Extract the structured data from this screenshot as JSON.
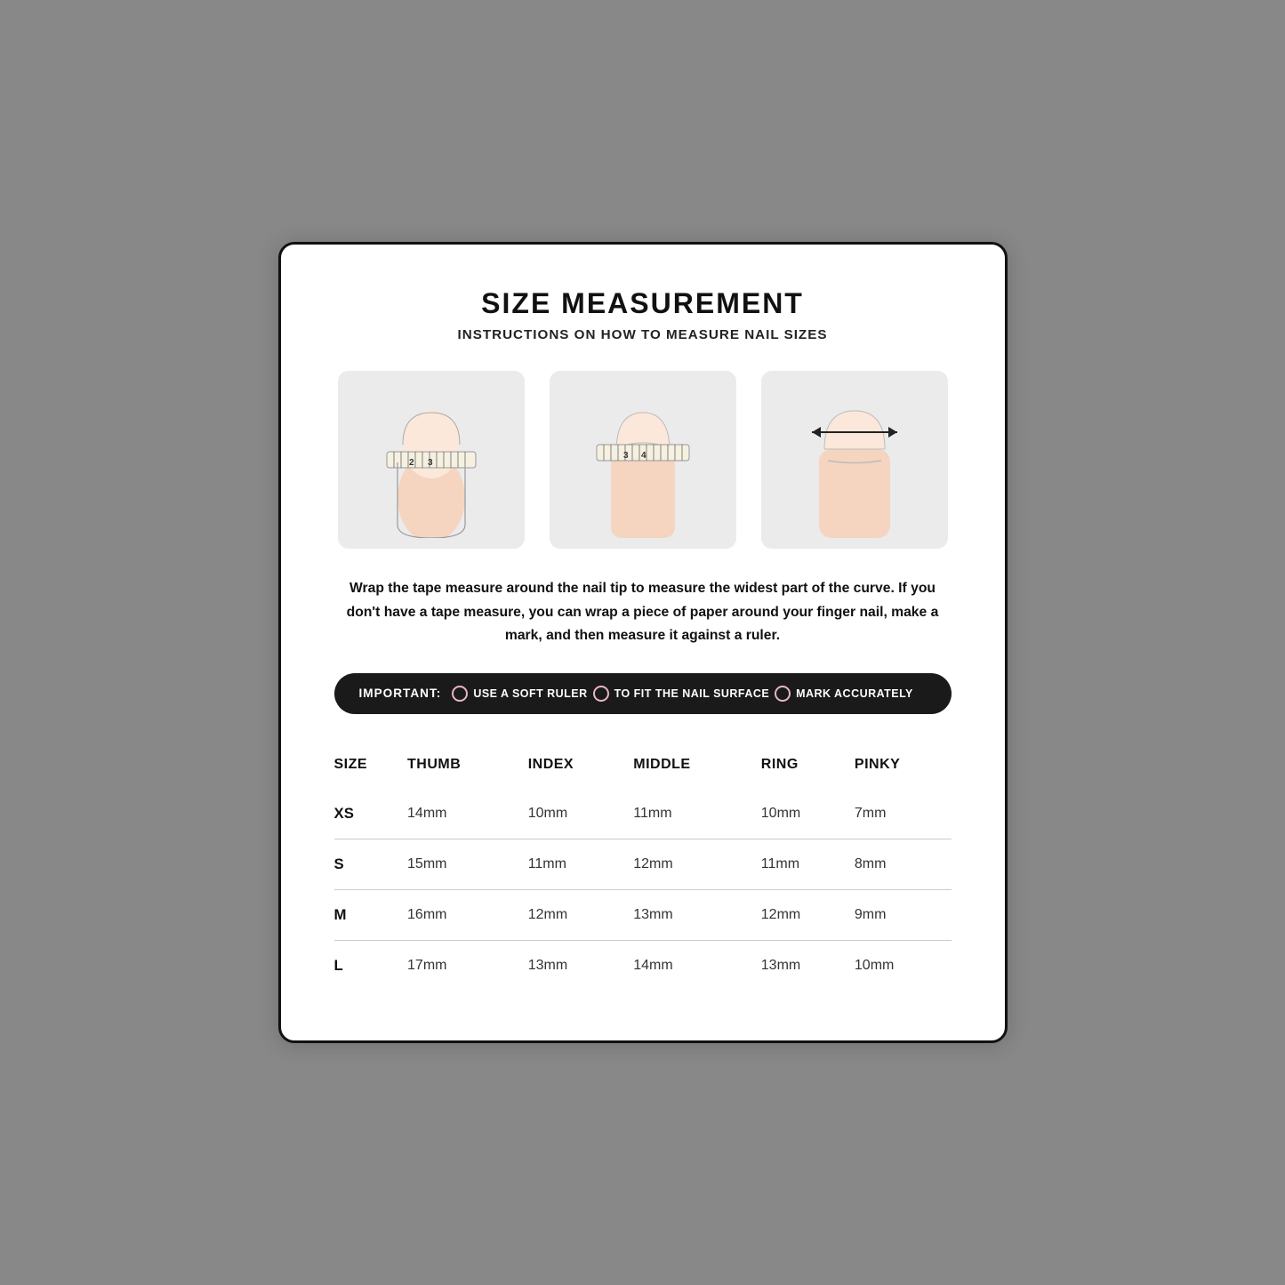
{
  "title": "SIZE MEASUREMENT",
  "subtitle": "INSTRUCTIONS ON HOW TO MEASURE NAIL SIZES",
  "description": "Wrap the tape measure around the nail tip to measure the widest part of the curve.\n If you don't have a tape measure, you can wrap a piece of paper around your finger\n nail, make a mark, and then measure it against a ruler.",
  "important": {
    "label": "IMPORTANT:",
    "items": [
      "USE A SOFT RULER",
      "TO FIT THE NAIL SURFACE",
      "MARK ACCURATELY"
    ]
  },
  "table": {
    "headers": [
      "SIZE",
      "THUMB",
      "INDEX",
      "MIDDLE",
      "RING",
      "PINKY"
    ],
    "rows": [
      {
        "size": "XS",
        "thumb": "14mm",
        "index": "10mm",
        "middle": "11mm",
        "ring": "10mm",
        "pinky": "7mm"
      },
      {
        "size": "S",
        "thumb": "15mm",
        "index": "11mm",
        "middle": "12mm",
        "ring": "11mm",
        "pinky": "8mm"
      },
      {
        "size": "M",
        "thumb": "16mm",
        "index": "12mm",
        "middle": "13mm",
        "ring": "12mm",
        "pinky": "9mm"
      },
      {
        "size": "L",
        "thumb": "17mm",
        "index": "13mm",
        "middle": "14mm",
        "ring": "13mm",
        "pinky": "10mm"
      }
    ]
  },
  "illustrations": [
    {
      "label": "nail-measure-wrap"
    },
    {
      "label": "nail-measure-front"
    },
    {
      "label": "nail-measure-width"
    }
  ]
}
